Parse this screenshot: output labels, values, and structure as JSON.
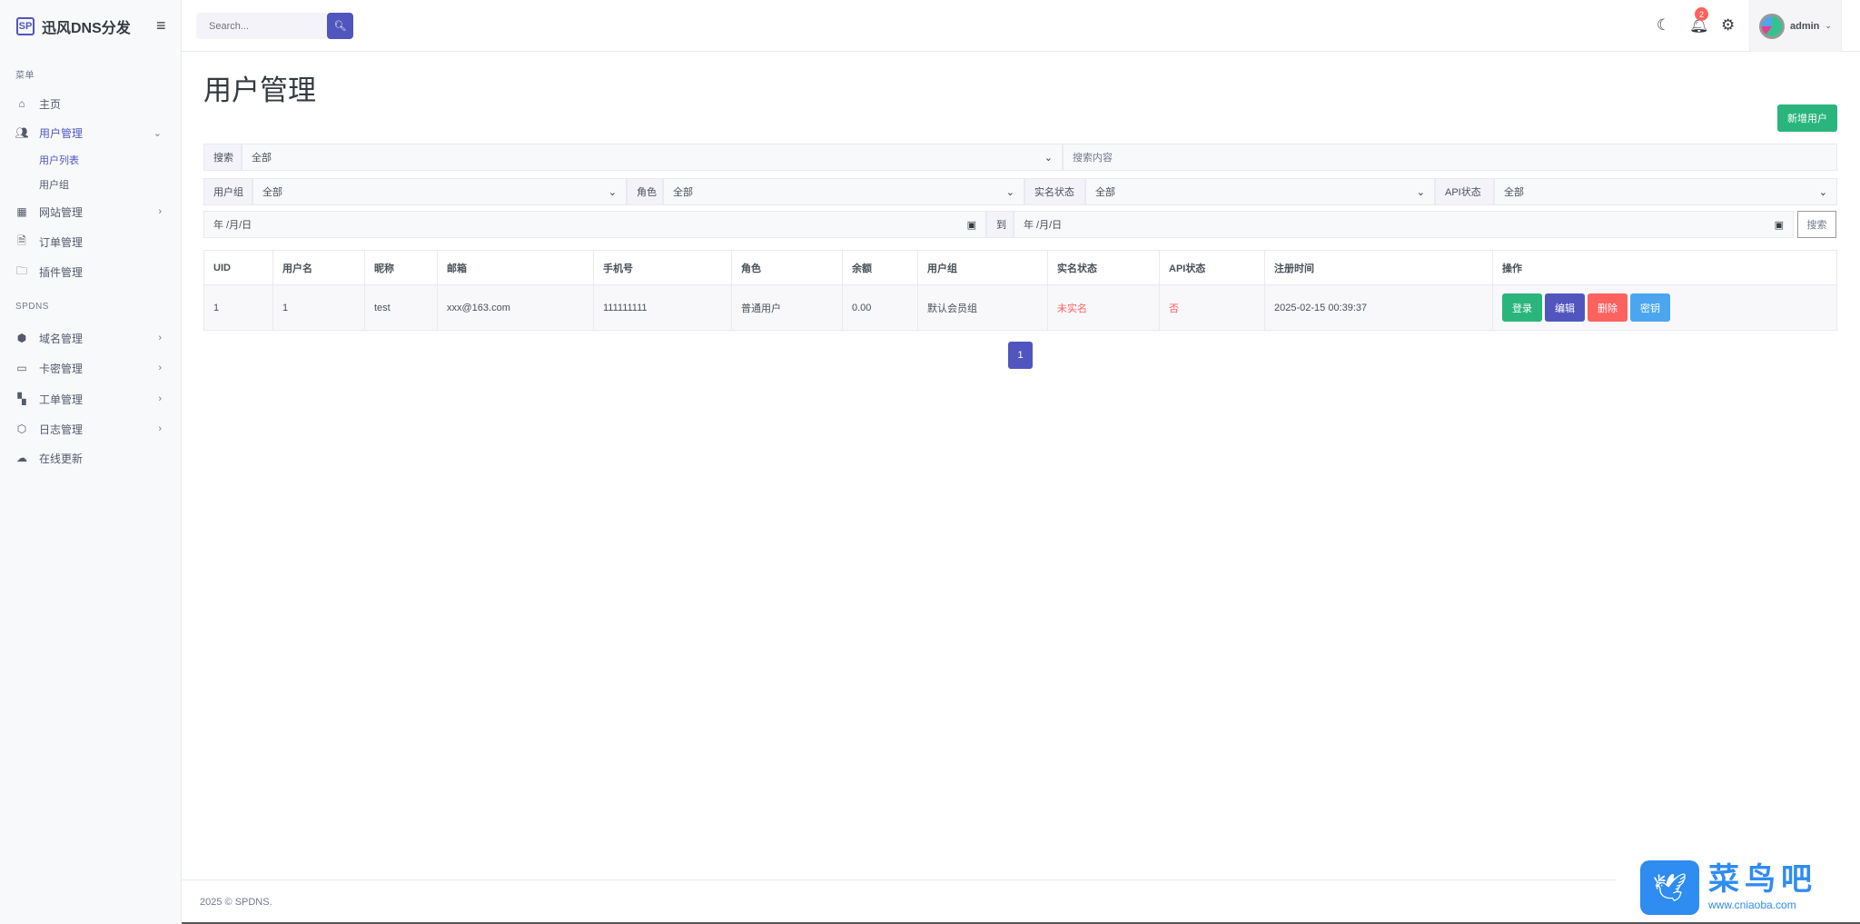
{
  "app": {
    "logo_mark": "SP",
    "name": "迅风DNS分发"
  },
  "sidebar": {
    "section_menu": "菜单",
    "section_spdns": "SPDNS",
    "items": [
      {
        "label": "主页",
        "icon": "home-icon"
      },
      {
        "label": "用户管理",
        "icon": "users-icon"
      },
      {
        "label": "网站管理",
        "icon": "layout-icon"
      },
      {
        "label": "订单管理",
        "icon": "file-icon"
      },
      {
        "label": "插件管理",
        "icon": "folder-icon"
      },
      {
        "label": "域名管理",
        "icon": "box-icon"
      },
      {
        "label": "卡密管理",
        "icon": "card-icon"
      },
      {
        "label": "工单管理",
        "icon": "grid-icon"
      },
      {
        "label": "日志管理",
        "icon": "package-icon"
      },
      {
        "label": "在线更新",
        "icon": "cloud-icon"
      }
    ],
    "subitems": [
      {
        "label": "用户列表"
      },
      {
        "label": "用户组"
      }
    ]
  },
  "topbar": {
    "search_placeholder": "Search...",
    "notification_count": "2",
    "username": "admin"
  },
  "page": {
    "title": "用户管理",
    "add_button": "新增用户"
  },
  "filters": {
    "search_label": "搜索",
    "search_field": "全部",
    "search_placeholder": "搜索内容",
    "group_label": "用户组",
    "group_value": "全部",
    "role_label": "角色",
    "role_value": "全部",
    "realname_label": "实名状态",
    "realname_value": "全部",
    "api_label": "API状态",
    "api_value": "全部",
    "date_from": "年 /月/日",
    "to_label": "到",
    "date_to": "年 /月/日",
    "search_button": "搜索"
  },
  "table": {
    "headers": [
      "UID",
      "用户名",
      "昵称",
      "邮箱",
      "手机号",
      "角色",
      "余额",
      "用户组",
      "实名状态",
      "API状态",
      "注册时间",
      "操作"
    ],
    "rows": [
      {
        "uid": "1",
        "username": "1",
        "nickname": "test",
        "email": "xxx@163.com",
        "phone": "111111111",
        "role": "普通用户",
        "balance": "0.00",
        "group": "默认会员组",
        "realname": "未实名",
        "api": "否",
        "registered": "2025-02-15 00:39:37",
        "actions": [
          "登录",
          "编辑",
          "删除",
          "密钥"
        ]
      }
    ]
  },
  "pagination": {
    "current": "1"
  },
  "footer": {
    "text": "2025 © SPDNS."
  },
  "watermark": {
    "title": "菜鸟吧",
    "url": "www.cniaoba.com"
  },
  "colors": {
    "primary": "#5156be",
    "success": "#2ab57d",
    "danger": "#fd625e",
    "info": "#4ba6ef"
  }
}
